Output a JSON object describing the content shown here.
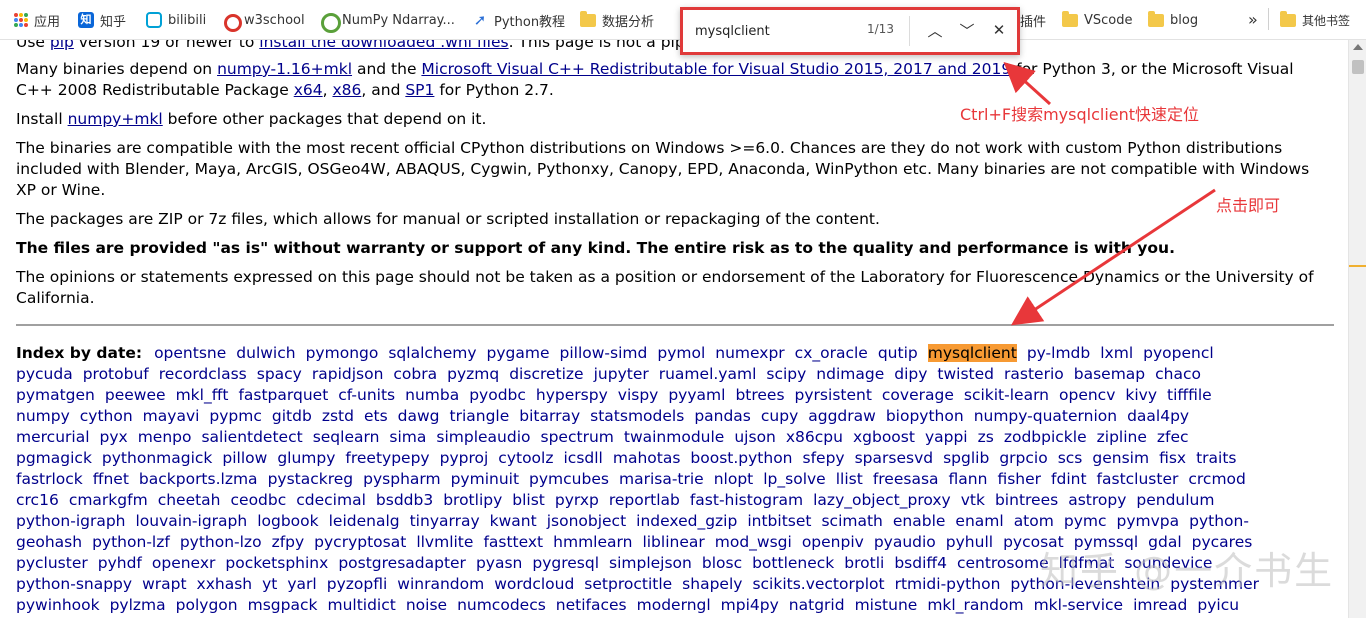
{
  "bookmarks": {
    "items": [
      {
        "label": "应用",
        "icon": "apps-grid-icon"
      },
      {
        "label": "知乎",
        "icon": "zhihu-icon"
      },
      {
        "label": "bilibili",
        "icon": "bilibili-icon"
      },
      {
        "label": "w3school",
        "icon": "w3school-icon"
      },
      {
        "label": "NumPy Ndarray...",
        "icon": "numpy-icon"
      },
      {
        "label": "Python教程",
        "icon": "rocket-icon"
      },
      {
        "label": "数据分析",
        "icon": "folder-icon"
      },
      {
        "label": "插件",
        "icon": "folder-icon"
      },
      {
        "label": "VScode",
        "icon": "folder-icon"
      },
      {
        "label": "blog",
        "icon": "folder-icon"
      }
    ],
    "overflow": "»",
    "other": "其他书签"
  },
  "find": {
    "query": "mysqlclient",
    "count": "1/13",
    "prev": "︿",
    "next": "﹀",
    "close": "✕"
  },
  "content": {
    "p0": {
      "a": "Use ",
      "l1": "pip",
      "b": " version 19 or newer to ",
      "l2": "install the downloaded .whl files",
      "c": ". This page is not a pip"
    },
    "p1": {
      "a": "Many binaries depend on ",
      "l1": "numpy-1.16+mkl",
      "b": " and the ",
      "l2": "Microsoft Visual C++ Redistributable for Visual Studio 2015, 2017 and 2019",
      "c": " for Python 3, or the Microsoft Visual C++ 2008 Redistributable Package ",
      "l3": "x64",
      "d": ", ",
      "l4": "x86",
      "e": ", and ",
      "l5": "SP1",
      "f": " for Python 2.7."
    },
    "p2": {
      "a": "Install ",
      "l1": "numpy+mkl",
      "b": " before other packages that depend on it."
    },
    "p3": "The binaries are compatible with the most recent official CPython distributions on Windows >=6.0. Chances are they do not work with custom Python distributions included with Blender, Maya, ArcGIS, OSGeo4W, ABAQUS, Cygwin, Pythonxy, Canopy, EPD, Anaconda, WinPython etc. Many binaries are not compatible with Windows XP or Wine.",
    "p4": "The packages are ZIP or 7z files, which allows for manual or scripted installation or repackaging of the content.",
    "p5": "The files are provided \"as is\" without warranty or support of any kind. The entire risk as to the quality and performance is with you.",
    "p6": "The opinions or statements expressed on this page should not be taken as a position or endorsement of the Laboratory for Fluorescence Dynamics or the University of California."
  },
  "index": {
    "label": "Index by date:",
    "highlight": "mysqlclient",
    "lines": [
      [
        "opentsne",
        "dulwich",
        "pymongo",
        "sqlalchemy",
        "pygame",
        "pillow-simd",
        "pymol",
        "numexpr",
        "cx_oracle",
        "qutip",
        "mysqlclient",
        "py-lmdb",
        "lxml",
        "pyopencl"
      ],
      [
        "pycuda",
        "protobuf",
        "recordclass",
        "spacy",
        "rapidjson",
        "cobra",
        "pyzmq",
        "discretize",
        "jupyter",
        "ruamel.yaml",
        "scipy",
        "ndimage",
        "dipy",
        "twisted",
        "rasterio",
        "basemap",
        "chaco"
      ],
      [
        "pymatgen",
        "peewee",
        "mkl_fft",
        "fastparquet",
        "cf-units",
        "numba",
        "pyodbc",
        "hyperspy",
        "vispy",
        "pyyaml",
        "btrees",
        "pyrsistent",
        "coverage",
        "scikit-learn",
        "opencv",
        "kivy",
        "tifffile"
      ],
      [
        "numpy",
        "cython",
        "mayavi",
        "pypmc",
        "gitdb",
        "zstd",
        "ets",
        "dawg",
        "triangle",
        "bitarray",
        "statsmodels",
        "pandas",
        "cupy",
        "aggdraw",
        "biopython",
        "numpy-quaternion",
        "daal4py"
      ],
      [
        "mercurial",
        "pyx",
        "menpo",
        "salientdetect",
        "seqlearn",
        "sima",
        "simpleaudio",
        "spectrum",
        "twainmodule",
        "ujson",
        "x86cpu",
        "xgboost",
        "yappi",
        "zs",
        "zodbpickle",
        "zipline",
        "zfec"
      ],
      [
        "pgmagick",
        "pythonmagick",
        "pillow",
        "glumpy",
        "freetypepy",
        "pyproj",
        "cytoolz",
        "icsdll",
        "mahotas",
        "boost.python",
        "sfepy",
        "sparsesvd",
        "spglib",
        "grpcio",
        "scs",
        "gensim",
        "fisx",
        "traits"
      ],
      [
        "fastrlock",
        "ffnet",
        "backports.lzma",
        "pystackreg",
        "pyspharm",
        "pyminuit",
        "pymcubes",
        "marisa-trie",
        "nlopt",
        "lp_solve",
        "llist",
        "freesasa",
        "flann",
        "fisher",
        "fdint",
        "fastcluster",
        "crcmod"
      ],
      [
        "crc16",
        "cmarkgfm",
        "cheetah",
        "ceodbc",
        "cdecimal",
        "bsddb3",
        "brotlipy",
        "blist",
        "pyrxp",
        "reportlab",
        "fast-histogram",
        "lazy_object_proxy",
        "vtk",
        "bintrees",
        "astropy",
        "pendulum"
      ],
      [
        "python-igraph",
        "louvain-igraph",
        "logbook",
        "leidenalg",
        "tinyarray",
        "kwant",
        "jsonobject",
        "indexed_gzip",
        "intbitset",
        "scimath",
        "enable",
        "enaml",
        "atom",
        "pymc",
        "pymvpa",
        "python-"
      ],
      [
        "geohash",
        "python-lzf",
        "python-lzo",
        "zfpy",
        "pycryptosat",
        "llvmlite",
        "fasttext",
        "hmmlearn",
        "liblinear",
        "mod_wsgi",
        "openpiv",
        "pyaudio",
        "pyhull",
        "pycosat",
        "pymssql",
        "gdal",
        "pycares"
      ],
      [
        "pycluster",
        "pyhdf",
        "openexr",
        "pocketsphinx",
        "postgresadapter",
        "pyasn",
        "pygresql",
        "simplejson",
        "blosc",
        "bottleneck",
        "brotli",
        "bsdiff4",
        "centrosome",
        "lfdfmat",
        "soundevice"
      ],
      [
        "python-snappy",
        "wrapt",
        "xxhash",
        "yt",
        "yarl",
        "pyzopfli",
        "winrandom",
        "wordcloud",
        "setproctitle",
        "shapely",
        "scikits.vectorplot",
        "rtmidi-python",
        "python-levenshtein",
        "pystemmer"
      ],
      [
        "pywinhook",
        "pylzma",
        "polygon",
        "msgpack",
        "multidict",
        "noise",
        "numcodecs",
        "netifaces",
        "moderngl",
        "mpi4py",
        "natgrid",
        "mistune",
        "mkl_random",
        "mkl-service",
        "imread",
        "pyicu"
      ]
    ]
  },
  "annotations": {
    "a1": "Ctrl+F搜索mysqlclient快速定位",
    "a2": "点击即可",
    "color": "#e8373a"
  },
  "watermark": "知乎 @一介书生"
}
